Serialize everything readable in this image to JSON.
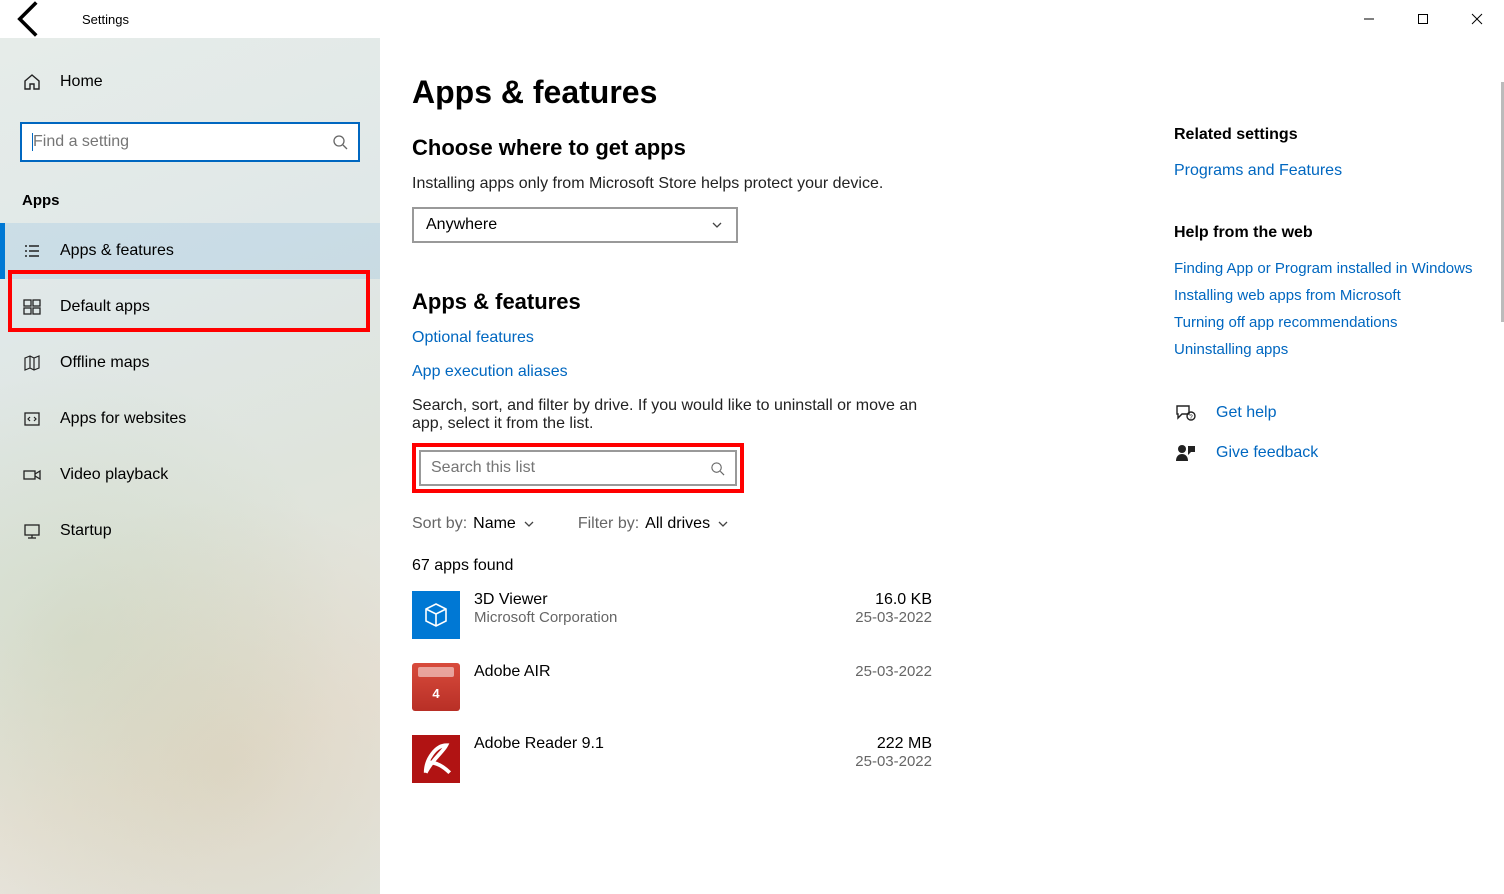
{
  "window": {
    "title": "Settings"
  },
  "sidebar": {
    "home": "Home",
    "search_placeholder": "Find a setting",
    "section": "Apps",
    "items": [
      {
        "label": "Apps & features"
      },
      {
        "label": "Default apps"
      },
      {
        "label": "Offline maps"
      },
      {
        "label": "Apps for websites"
      },
      {
        "label": "Video playback"
      },
      {
        "label": "Startup"
      }
    ]
  },
  "main": {
    "title": "Apps & features",
    "section1_heading": "Choose where to get apps",
    "section1_descr": "Installing apps only from Microsoft Store helps protect your device.",
    "dropdown_value": "Anywhere",
    "section2_heading": "Apps & features",
    "link_optional": "Optional features",
    "link_aliases": "App execution aliases",
    "search_descr": "Search, sort, and filter by drive. If you would like to uninstall or move an app, select it from the list.",
    "search_placeholder": "Search this list",
    "sort_label": "Sort by:",
    "sort_value": "Name",
    "filter_label": "Filter by:",
    "filter_value": "All drives",
    "count_text": "67 apps found",
    "apps": [
      {
        "name": "3D Viewer",
        "publisher": "Microsoft Corporation",
        "size": "16.0 KB",
        "date": "25-03-2022"
      },
      {
        "name": "Adobe AIR",
        "publisher": "",
        "size": "",
        "date": "25-03-2022"
      },
      {
        "name": "Adobe Reader 9.1",
        "publisher": "",
        "size": "222 MB",
        "date": "25-03-2022"
      }
    ]
  },
  "aside": {
    "related_heading": "Related settings",
    "related_link": "Programs and Features",
    "help_heading": "Help from the web",
    "help_links": [
      "Finding App or Program installed in Windows",
      "Installing web apps from Microsoft",
      "Turning off app recommendations",
      "Uninstalling apps"
    ],
    "get_help": "Get help",
    "give_feedback": "Give feedback"
  }
}
